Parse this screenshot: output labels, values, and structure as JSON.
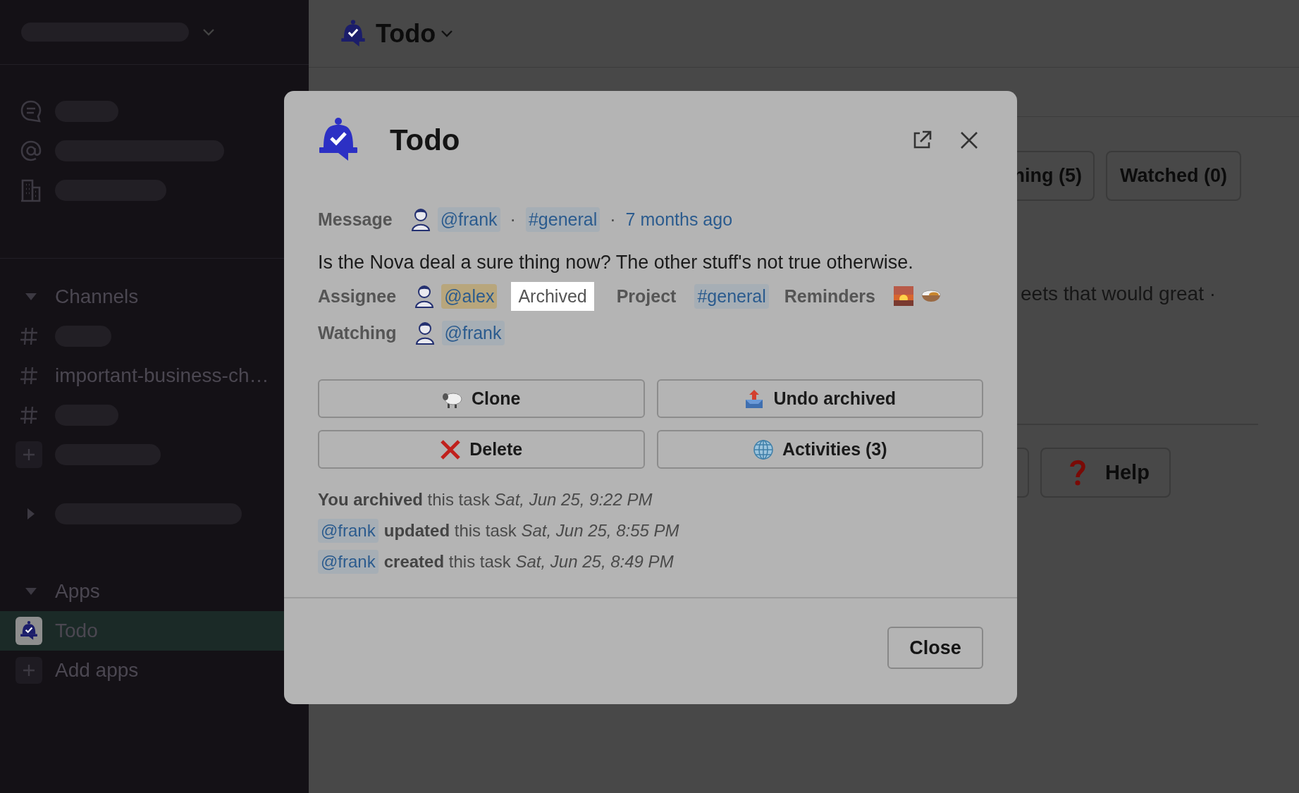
{
  "sidebar": {
    "nav": [
      {
        "kind": "threads"
      },
      {
        "kind": "mentions"
      },
      {
        "kind": "directory"
      }
    ],
    "sections": [
      {
        "kind": "list",
        "title": "Channels",
        "expanded": true,
        "items": [
          {
            "kind": "redacted",
            "selected": false
          },
          {
            "kind": "channel",
            "label": "important-business-ch…",
            "selected": false
          },
          {
            "kind": "redacted",
            "selected": false
          },
          {
            "kind": "add-redacted",
            "selected": false
          }
        ]
      },
      {
        "kind": "redacted",
        "expanded": false
      },
      {
        "kind": "list",
        "title": "Apps",
        "expanded": true,
        "items": [
          {
            "kind": "app",
            "label": "Todo",
            "selected": true
          },
          {
            "kind": "add",
            "label": "Add apps",
            "selected": false
          }
        ]
      }
    ]
  },
  "main": {
    "title": "Todo",
    "filters": [
      "ning (5)",
      "Watched (0)"
    ],
    "snippet": "eets that would great ·",
    "actions": [
      {
        "kind": "hidden"
      },
      {
        "kind": "help",
        "label": "Help"
      }
    ]
  },
  "dialog": {
    "title": "Todo",
    "meta": {
      "label": "Message",
      "parts": [
        {
          "kind": "user",
          "text": "@frank",
          "highlight": false
        },
        {
          "kind": "separator",
          "text": "·"
        },
        {
          "kind": "channel",
          "text": "#general"
        },
        {
          "kind": "separator",
          "text": "·"
        },
        {
          "kind": "link",
          "text": "7 months ago"
        }
      ]
    },
    "body": "Is the Nova deal a sure thing now? The other stuff's not true otherwise.",
    "properties": [
      {
        "parts": [
          {
            "kind": "label",
            "text": "Assignee"
          },
          {
            "kind": "user",
            "text": "@alex",
            "highlight": true
          },
          {
            "kind": "status",
            "text": "Archived"
          },
          {
            "kind": "label",
            "text": "Project"
          },
          {
            "kind": "channel",
            "text": "#general"
          },
          {
            "kind": "label",
            "text": "Reminders"
          },
          {
            "kind": "sunrise"
          },
          {
            "kind": "curry"
          }
        ]
      },
      {
        "parts": [
          {
            "kind": "label",
            "text": "Watching"
          },
          {
            "kind": "user",
            "text": "@frank",
            "highlight": false
          }
        ]
      }
    ],
    "buttons": [
      {
        "kind": "clone",
        "label": "Clone"
      },
      {
        "kind": "unarchive",
        "label": "Undo archived"
      },
      {
        "kind": "delete",
        "label": "Delete"
      },
      {
        "kind": "activities",
        "label": "Activities (3)"
      }
    ],
    "activity": [
      {
        "text": "**You archived** this task *Sat, Jun 25, 9:22 PM*"
      },
      {
        "actor": "@frank",
        "text": "**updated** this task *Sat, Jun 25, 8:55 PM*"
      },
      {
        "actor": "@frank",
        "text": "**created** this task *Sat, Jun 25, 8:49 PM*"
      }
    ],
    "close": "Close"
  }
}
